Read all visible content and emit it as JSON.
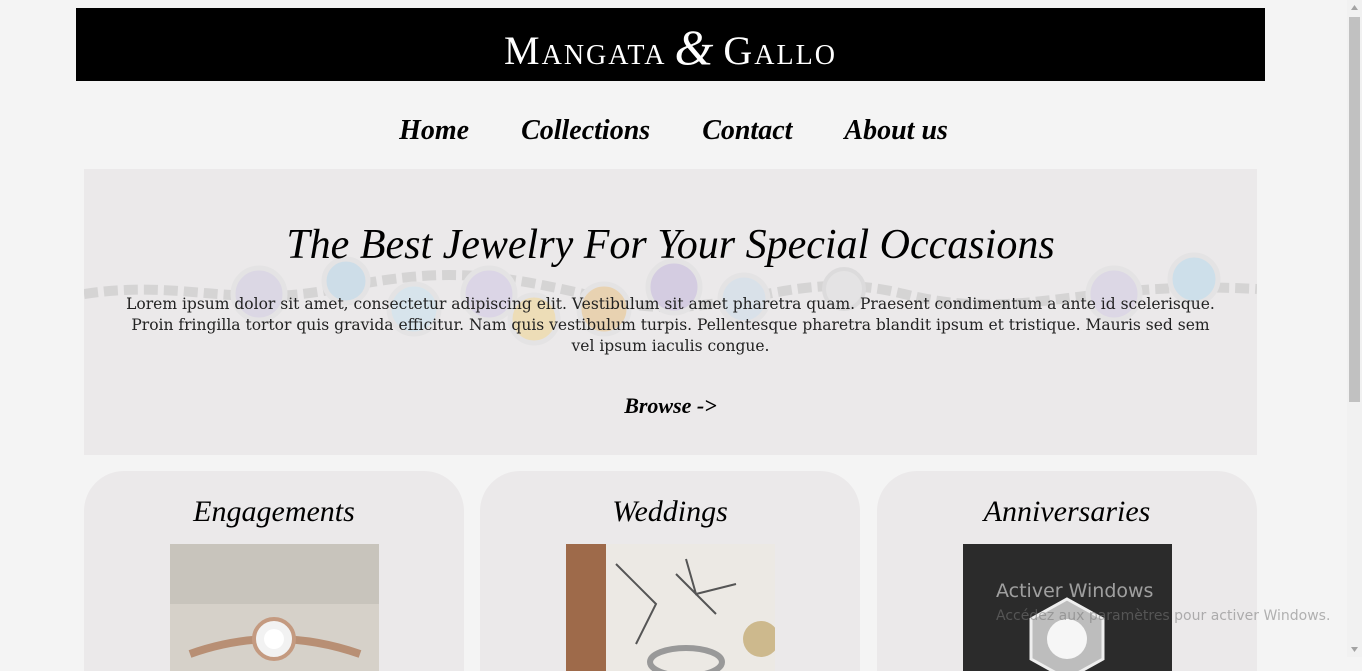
{
  "header": {
    "logo_left": "Mangata",
    "logo_amp": "&",
    "logo_right": "Gallo"
  },
  "nav": {
    "items": [
      "Home",
      "Collections",
      "Contact",
      "About us"
    ]
  },
  "hero": {
    "title": "The Best Jewelry For Your Special Occasions",
    "body": "Lorem ipsum dolor sit amet, consectetur adipiscing elit. Vestibulum sit amet pharetra quam. Praesent condimentum a ante id scelerisque. Proin fringilla tortor quis gravida efficitur. Nam quis vestibulum turpis. Pellentesque pharetra blandit ipsum et tristique. Mauris sed sem vel ipsum iaculis congue.",
    "browse": "Browse ->"
  },
  "cards": [
    {
      "title": "Engagements"
    },
    {
      "title": "Weddings"
    },
    {
      "title": "Anniversaries"
    }
  ],
  "watermark": {
    "title": "Activer Windows",
    "subtitle": "Accédez aux paramètres pour activer Windows."
  },
  "colors": {
    "banner": "#000000",
    "page_bg": "#f4f4f4",
    "panel_bg": "#ebe9ea"
  }
}
